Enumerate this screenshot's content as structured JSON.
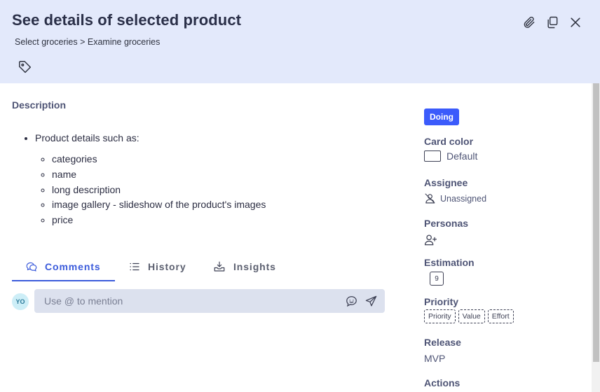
{
  "header": {
    "title": "See details of selected product",
    "breadcrumb": "Select groceries > Examine groceries"
  },
  "description": {
    "label": "Description",
    "intro": "Product details such as:",
    "items": [
      "categories",
      "name",
      "long description",
      "image gallery - slideshow of the product's images",
      "price"
    ]
  },
  "tabs": [
    {
      "label": "Comments",
      "active": true
    },
    {
      "label": "History",
      "active": false
    },
    {
      "label": "Insights",
      "active": false
    }
  ],
  "comment": {
    "avatar_initials": "YO",
    "placeholder": "Use @ to mention"
  },
  "sidebar": {
    "status": "Doing",
    "card_color_label": "Card color",
    "card_color_value": "Default",
    "assignee_label": "Assignee",
    "assignee_value": "Unassigned",
    "personas_label": "Personas",
    "estimation_label": "Estimation",
    "estimation_value": "9",
    "priority_label": "Priority",
    "priority_chips": [
      "Priority",
      "Value",
      "Effort"
    ],
    "release_label": "Release",
    "release_value": "MVP",
    "actions_label": "Actions"
  },
  "colors": {
    "header_bg": "#e3e9fb",
    "accent": "#3b5bdb",
    "status_badge": "#3b5bfb"
  }
}
